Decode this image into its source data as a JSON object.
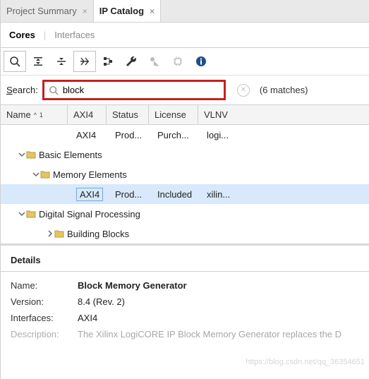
{
  "tabs": [
    {
      "label": "Project Summary",
      "active": false
    },
    {
      "label": "IP Catalog",
      "active": true
    }
  ],
  "subtabs": {
    "cores": "Cores",
    "interfaces": "Interfaces"
  },
  "search": {
    "label_prefix": "S",
    "label_rest": "earch:",
    "value": "block",
    "matches": "(6 matches)"
  },
  "columns": {
    "name": "Name",
    "axi": "AXI4",
    "status": "Status",
    "license": "License",
    "vlnv": "VLNV",
    "sort": "1"
  },
  "rows": {
    "r0": {
      "axi": "AXI4",
      "status": "Prod...",
      "license": "Purch...",
      "vlnv": "logi..."
    },
    "r1": {
      "name": "Basic Elements"
    },
    "r2": {
      "name": "Memory Elements"
    },
    "r3": {
      "axi": "AXI4",
      "status": "Prod...",
      "license": "Included",
      "vlnv": "xilin..."
    },
    "r4": {
      "name": "Digital Signal Processing"
    },
    "r5": {
      "name": "Building Blocks"
    }
  },
  "details": {
    "title": "Details",
    "name_label": "Name:",
    "name_value": "Block Memory Generator",
    "version_label": "Version:",
    "version_value": "8.4 (Rev. 2)",
    "interfaces_label": "Interfaces:",
    "interfaces_value": "AXI4",
    "desc_label": "Description:",
    "desc_value": "The Xilinx LogiCORE IP Block Memory Generator replaces the D"
  },
  "watermark": "https://blog.csdn.net/qq_36354651"
}
